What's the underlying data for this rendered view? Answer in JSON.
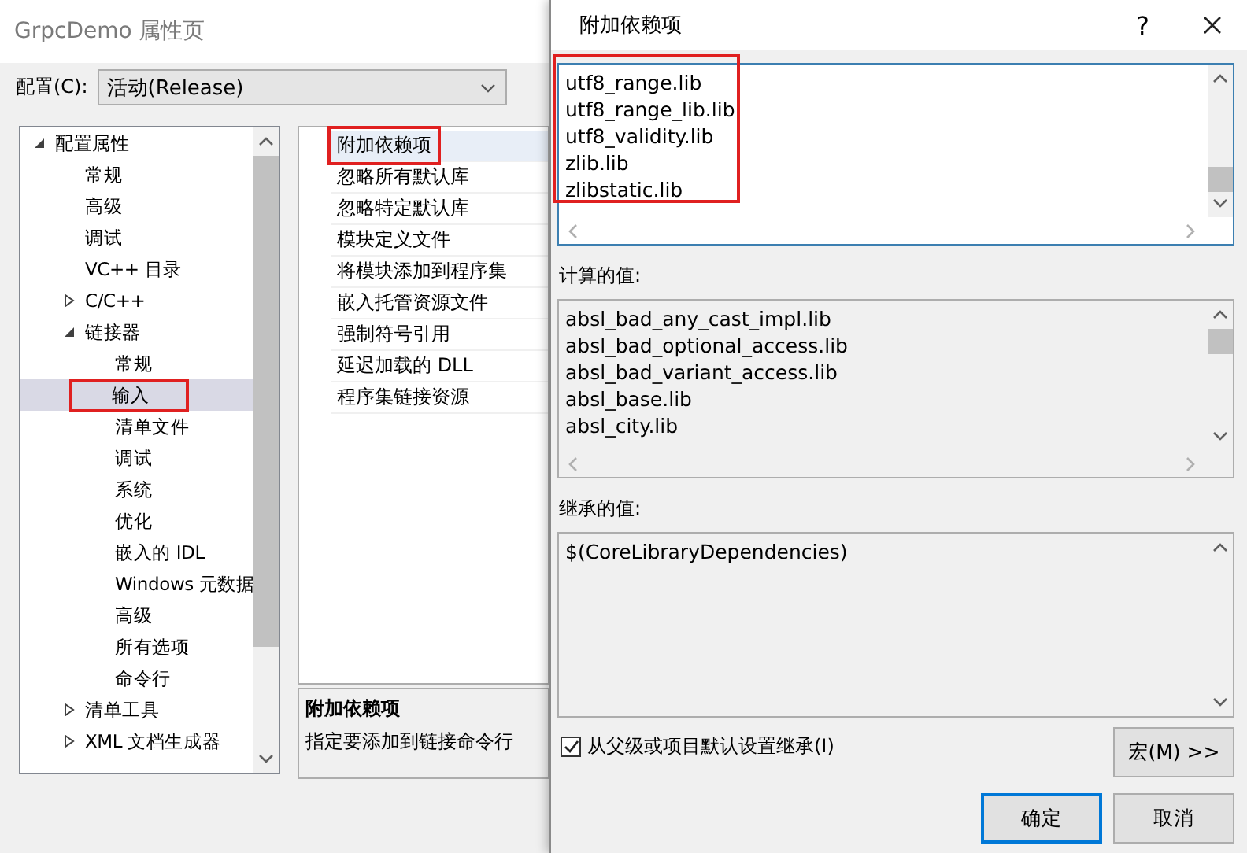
{
  "back_window": {
    "title": "GrpcDemo 属性页",
    "config_label": "配置(C):",
    "config_value": "活动(Release)",
    "tree": [
      {
        "label": "配置属性",
        "expanded": true,
        "selected": false,
        "highlighted": false,
        "children": [
          {
            "label": "常规",
            "selected": false,
            "highlighted": false
          },
          {
            "label": "高级",
            "selected": false,
            "highlighted": false
          },
          {
            "label": "调试",
            "selected": false,
            "highlighted": false
          },
          {
            "label": "VC++ 目录",
            "selected": false,
            "highlighted": false
          },
          {
            "label": "C/C++",
            "expanded": false,
            "selected": false,
            "highlighted": false
          },
          {
            "label": "链接器",
            "expanded": true,
            "selected": false,
            "highlighted": false,
            "children": [
              {
                "label": "常规",
                "selected": false,
                "highlighted": false
              },
              {
                "label": "输入",
                "selected": true,
                "highlighted": true
              },
              {
                "label": "清单文件",
                "selected": false,
                "highlighted": false
              },
              {
                "label": "调试",
                "selected": false,
                "highlighted": false
              },
              {
                "label": "系统",
                "selected": false,
                "highlighted": false
              },
              {
                "label": "优化",
                "selected": false,
                "highlighted": false
              },
              {
                "label": "嵌入的 IDL",
                "selected": false,
                "highlighted": false
              },
              {
                "label": "Windows 元数据",
                "selected": false,
                "highlighted": false
              },
              {
                "label": "高级",
                "selected": false,
                "highlighted": false
              },
              {
                "label": "所有选项",
                "selected": false,
                "highlighted": false
              },
              {
                "label": "命令行",
                "selected": false,
                "highlighted": false
              }
            ]
          },
          {
            "label": "清单工具",
            "expanded": false,
            "selected": false,
            "highlighted": false
          },
          {
            "label": "XML 文档生成器",
            "expanded": false,
            "selected": false,
            "highlighted": false
          }
        ]
      }
    ],
    "properties": [
      {
        "label": "附加依赖项",
        "selected": true,
        "highlighted": true
      },
      {
        "label": "忽略所有默认库",
        "selected": false,
        "highlighted": false
      },
      {
        "label": "忽略特定默认库",
        "selected": false,
        "highlighted": false
      },
      {
        "label": "模块定义文件",
        "selected": false,
        "highlighted": false
      },
      {
        "label": "将模块添加到程序集",
        "selected": false,
        "highlighted": false
      },
      {
        "label": "嵌入托管资源文件",
        "selected": false,
        "highlighted": false
      },
      {
        "label": "强制符号引用",
        "selected": false,
        "highlighted": false
      },
      {
        "label": "延迟加载的 DLL",
        "selected": false,
        "highlighted": false
      },
      {
        "label": "程序集链接资源",
        "selected": false,
        "highlighted": false
      }
    ],
    "description": {
      "title": "附加依赖项",
      "text": "指定要添加到链接命令行"
    }
  },
  "dialog": {
    "title": "附加依赖项",
    "help": "?",
    "edit_lines": [
      "utf8_range.lib",
      "utf8_range_lib.lib",
      "utf8_validity.lib",
      "zlib.lib",
      "zlibstatic.lib"
    ],
    "edit_highlighted": true,
    "computed_label": "计算的值:",
    "computed_lines": [
      "absl_bad_any_cast_impl.lib",
      "absl_bad_optional_access.lib",
      "absl_bad_variant_access.lib",
      "absl_base.lib",
      "absl_city.lib"
    ],
    "inherited_label": "继承的值:",
    "inherited_lines": [
      "$(CoreLibraryDependencies)"
    ],
    "inherit_checkbox": {
      "label": "从父级或项目默认设置继承(I)",
      "checked": true
    },
    "macro_button": "宏(M) >>",
    "buttons": [
      {
        "label": "确定",
        "kind": "default"
      },
      {
        "label": "取消",
        "kind": "normal"
      }
    ]
  }
}
